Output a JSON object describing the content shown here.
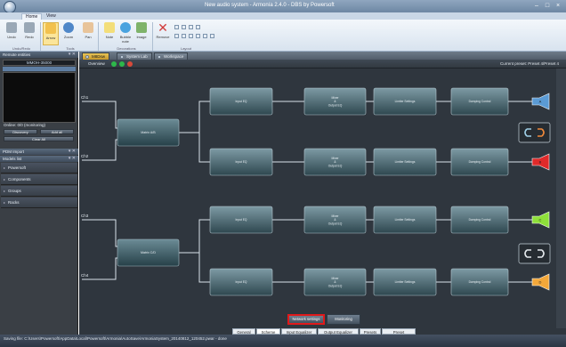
{
  "window": {
    "title": "New audio system - Armonía 2.4.0 - DBS by Powersoft",
    "controls": [
      "–",
      "□",
      "×"
    ]
  },
  "ribbon": {
    "tabs": [
      "Home",
      "View"
    ],
    "buttons": [
      {
        "label": "Undo",
        "icon": "undo-icon",
        "color": "#9aa8b6"
      },
      {
        "label": "Redo",
        "icon": "redo-icon",
        "color": "#9aa8b6"
      },
      {
        "label": "Arrow",
        "icon": "arrow-cursor-icon",
        "color": "#f2c14e",
        "active": true
      },
      {
        "label": "Zoom",
        "icon": "zoom-icon",
        "color": "#4f87c8"
      },
      {
        "label": "Pan",
        "icon": "hand-pan-icon",
        "color": "#e8c49a"
      },
      {
        "label": "Note",
        "icon": "note-icon",
        "color": "#f3de7a"
      },
      {
        "label": "Bubble note",
        "icon": "bubble-note-icon",
        "color": "#4aa3df"
      },
      {
        "label": "Image",
        "icon": "image-icon",
        "color": "#7fb36a"
      },
      {
        "label": "Remove",
        "icon": "remove-icon",
        "color": "#d23b3b"
      }
    ],
    "groups": [
      "Undo/Redo",
      "Tools",
      "Decorations",
      "Layout"
    ]
  },
  "left_panel": {
    "remote_header": "Remote entities",
    "selector_label": "MMOH-35000",
    "online_label": "Online: 0/0 (monitoring)",
    "buttons": [
      "Discovery",
      "Add all",
      "Clear All"
    ],
    "pdm_header": "PDM Import",
    "models_header": "Models list",
    "nav_items": [
      "Powersoft",
      "Components",
      "Groups",
      "Racks"
    ]
  },
  "doc_tabs": [
    "M8Dsw",
    "System Lab",
    "Workspace"
  ],
  "overview": {
    "label": "Overview",
    "leds": [
      "#2db84a",
      "#2db84a",
      "#d84a3a"
    ],
    "right_label": "Current preset: Preset 4/Preset 4"
  },
  "diagram": {
    "channels": [
      {
        "name": "Ch1",
        "in_label": "Input EQ",
        "mixer": "Mixer\n&\nOutput EQ",
        "limiter": "Limiter Settings",
        "damping": "Damping Control",
        "arrow_color": "#5b9bd5",
        "out": "A"
      },
      {
        "name": "Ch2",
        "in_label": "Input EQ",
        "mixer": "Mixer\n&\nOutput EQ",
        "limiter": "Limiter Settings",
        "damping": "Damping Control",
        "arrow_color": "#e02a2a",
        "out": "B"
      },
      {
        "name": "Ch3",
        "in_label": "Input EQ",
        "mixer": "Mixer\n&\nOutput EQ",
        "limiter": "Limiter Settings",
        "damping": "Damping Control",
        "arrow_color": "#8fe03a",
        "out": "C"
      },
      {
        "name": "Ch4",
        "in_label": "Input EQ",
        "mixer": "Mixer\n&\nOutput EQ",
        "limiter": "Limiter Settings",
        "damping": "Damping Control",
        "arrow_color": "#f4a83a",
        "out": "D"
      }
    ],
    "matrix_labels": [
      "Matrix A/B",
      "Matrix C/D"
    ],
    "bridge_icon": "bridge-link-icon"
  },
  "footer_buttons": [
    "Network settings",
    "Monitoring"
  ],
  "bottom_tabs": [
    "General",
    "Scheme",
    "Input Equalizer",
    "Output Equalizer",
    "Presets",
    "Preset Manager"
  ],
  "status": "Saving file: C:\\Users\\Powersoft\\AppData\\Local\\Powersoft\\Armonia\\AutoSave\\ArmoniaSystem_20140812_120452.pwar - done"
}
